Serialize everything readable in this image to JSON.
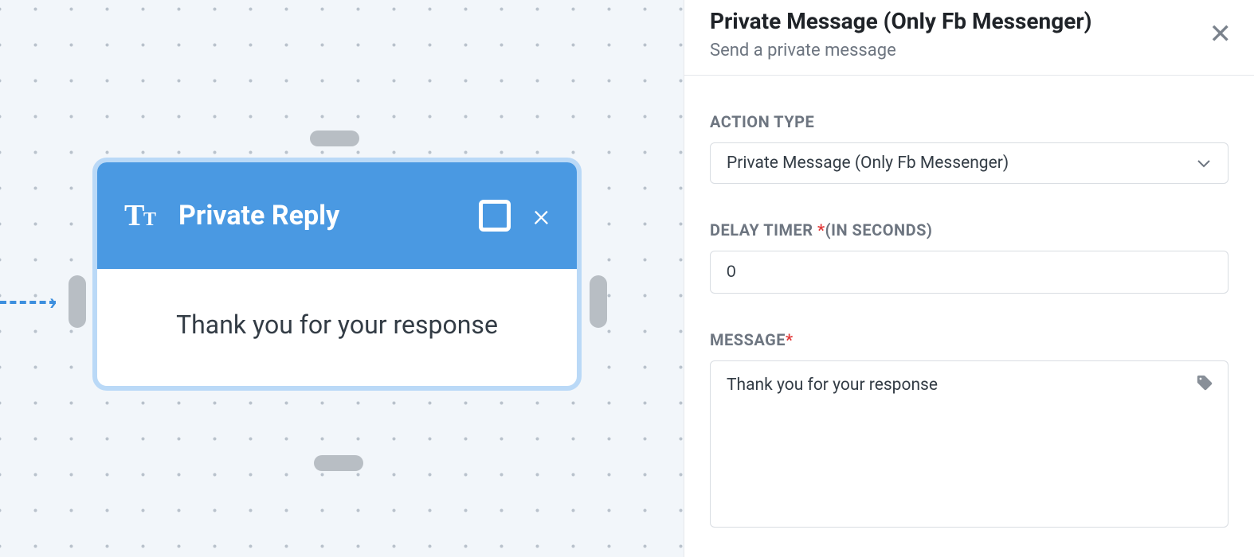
{
  "canvas": {
    "node": {
      "title": "Private Reply",
      "body": "Thank you for your response"
    }
  },
  "sidebar": {
    "title": "Private Message (Only Fb Messenger)",
    "subtitle": "Send a private message",
    "actionType": {
      "label": "ACTION TYPE",
      "value": "Private Message (Only Fb Messenger)"
    },
    "delayTimer": {
      "label": "DELAY TIMER ",
      "suffix": "(IN SECONDS)",
      "value": "0"
    },
    "message": {
      "label": "MESSAGE",
      "value": "Thank you for your response"
    }
  }
}
